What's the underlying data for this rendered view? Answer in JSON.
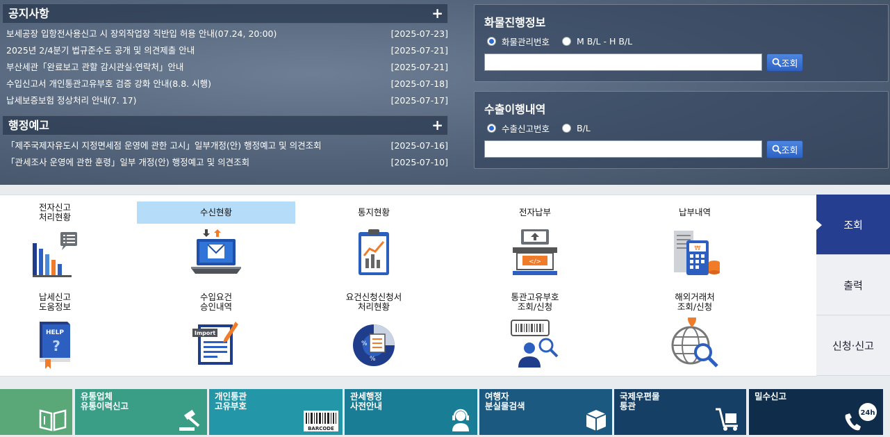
{
  "notices": {
    "title": "공지사항",
    "plus": "+",
    "items": [
      {
        "text": "보세공장 입항전사용신고 시 장외작업장 직반입 허용 안내(07.24, 20:00)",
        "date": "[2025-07-23]"
      },
      {
        "text": "2025년 2/4분기 법규준수도 공개 및 의견제출 안내",
        "date": "[2025-07-21]"
      },
      {
        "text": "부산세관「완료보고 관할 감시관실·연락처」안내",
        "date": "[2025-07-21]"
      },
      {
        "text": "수입신고서 개인통관고유부호 검증 강화 안내(8.8. 시행)",
        "date": "[2025-07-18]"
      },
      {
        "text": "납세보증보험 정상처리 안내(7. 17)",
        "date": "[2025-07-17]"
      }
    ]
  },
  "admin_notice": {
    "title": "행정예고",
    "plus": "+",
    "items": [
      {
        "text": "「제주국제자유도시 지정면세점 운영에 관한 고시」일부개정(안) 행정예고 및 의견조회",
        "date": "[2025-07-16]"
      },
      {
        "text": "「관세조사 운영에 관한 훈령」일부 개정(안) 행정예고 및 의견조회",
        "date": "[2025-07-10]"
      }
    ]
  },
  "cargo": {
    "title": "화물진행정보",
    "options": [
      "화물관리번호",
      "M B/L - H B/L"
    ],
    "selected": 0,
    "input_value": "",
    "search_label": "조회"
  },
  "export": {
    "title": "수출이행내역",
    "options": [
      "수출신고번호",
      "B/L"
    ],
    "selected": 0,
    "input_value": "",
    "search_label": "조회"
  },
  "menu": {
    "items": [
      {
        "label": "전자신고\n처리현황",
        "icon": "bar-chart-icon"
      },
      {
        "label": "수신현황",
        "icon": "laptop-mail-icon",
        "active": true
      },
      {
        "label": "통지현황",
        "icon": "clipboard-chart-icon"
      },
      {
        "label": "전자납부",
        "icon": "atm-payment-icon"
      },
      {
        "label": "납부내역",
        "icon": "receipt-calculator-icon"
      },
      {
        "label": "납세신고\n도움정보",
        "icon": "help-book-icon"
      },
      {
        "label": "수입요건\n승인내역",
        "icon": "import-document-icon"
      },
      {
        "label": "요건신청신청서\n처리현황",
        "icon": "percent-pie-icon"
      },
      {
        "label": "통관고유부호\n조회/신청",
        "icon": "barcode-person-icon"
      },
      {
        "label": "해외거래처\n조회/신청",
        "icon": "globe-search-icon"
      }
    ]
  },
  "side_tabs": {
    "items": [
      "조회",
      "출력",
      "신청·신고"
    ],
    "selected": 0
  },
  "tiles": {
    "items": [
      {
        "label": "",
        "color": "#5aa878",
        "icon": "book-icon"
      },
      {
        "label": "유통업체\n유통이력신고",
        "color": "#3a9e86",
        "icon": "gavel-icon"
      },
      {
        "label": "개인통관\n고유부호",
        "color": "#2397a8",
        "icon": "barcode-icon",
        "icon_text": "BARCODE"
      },
      {
        "label": "관세행정\n사전안내",
        "color": "#1a7d96",
        "icon": "headset-person-icon"
      },
      {
        "label": "여행자\n분실물검색",
        "color": "#1c5980",
        "icon": "box-icon"
      },
      {
        "label": "국제우편물\n통관",
        "color": "#163f66",
        "icon": "handcart-icon"
      },
      {
        "label": "밀수신고",
        "color": "#0f2c4a",
        "icon": "phone-24h-icon",
        "icon_text": "24h"
      }
    ]
  }
}
